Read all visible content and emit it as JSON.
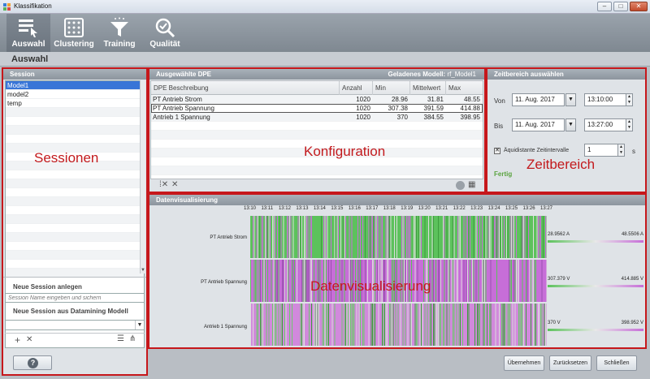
{
  "window": {
    "title": "Klassifikation",
    "controls": [
      "–",
      "□",
      "✕"
    ]
  },
  "toolbar": {
    "items": [
      {
        "label": "Auswahl",
        "icon": "selection-list-icon",
        "active": true
      },
      {
        "label": "Clustering",
        "icon": "cluster-grid-icon",
        "active": false
      },
      {
        "label": "Training",
        "icon": "filter-funnel-icon",
        "active": false
      },
      {
        "label": "Qualität",
        "icon": "magnifier-check-icon",
        "active": false
      }
    ]
  },
  "section": {
    "title": "Auswahl"
  },
  "session": {
    "header": "Session",
    "items": [
      "Model1",
      "model2",
      "temp"
    ],
    "selected": "Model1",
    "annotation": "Sessionen",
    "new_session_label": "Neue Session anlegen",
    "new_session_placeholder": "Session Name eingeben und sichern",
    "new_dm_label": "Neue Session aus Datamining Modell",
    "help": "?"
  },
  "config": {
    "header": "Ausgewählte DPE",
    "model_label": "Geladenes Modell:",
    "model_value": "rf_Model1",
    "annotation": "Konfiguration",
    "columns": [
      "DPE Beschreibung",
      "Anzahl",
      "Min",
      "Mittelwert",
      "Max"
    ],
    "rows": [
      [
        "PT Antrieb Strom",
        "1020",
        "28.96",
        "31.81",
        "48.55"
      ],
      [
        "PT Antrieb Spannung",
        "1020",
        "307.38",
        "391.59",
        "414.88"
      ],
      [
        "Antrieb 1 Spannung",
        "1020",
        "370",
        "384.55",
        "398.95"
      ]
    ]
  },
  "time": {
    "header": "Zeitbereich auswählen",
    "von_label": "Von",
    "von_date": "11. Aug. 2017",
    "von_time": "13:10:00",
    "bis_label": "Bis",
    "bis_date": "11. Aug. 2017",
    "bis_time": "13:27:00",
    "equidistant_label": "Äquidistante Zeitintervalle",
    "equidistant_checked": true,
    "interval_value": "1",
    "interval_unit": "s",
    "status": "Fertig",
    "annotation": "Zeitbereich"
  },
  "vis": {
    "header": "Datenvisualisierung",
    "annotation": "Datenvisualisierung",
    "ticks": [
      "13:10",
      "13:11",
      "13:12",
      "13:13",
      "13:14",
      "13:15",
      "13:16",
      "13:17",
      "13:18",
      "13:19",
      "13:20",
      "13:21",
      "13:22",
      "13:23",
      "13:24",
      "13:25",
      "13:26",
      "13:27"
    ],
    "rows": [
      {
        "label": "PT Antrieb Strom",
        "min": "28.9562 A",
        "max": "48.5506 A",
        "dominant": "#5cc25c",
        "secondary": "#c76ed8"
      },
      {
        "label": "PT Antrieb Spannung",
        "min": "307.379 V",
        "max": "414.885 V",
        "dominant": "#c76ed8",
        "secondary": "#5cc25c"
      },
      {
        "label": "Antrieb 1 Spannung",
        "min": "370 V",
        "max": "398.952 V",
        "dominant": "#d189dc",
        "secondary": "#6ec86e"
      }
    ]
  },
  "footer": {
    "apply": "Übernehmen",
    "reset": "Zurücksetzen",
    "close": "Schließen"
  },
  "colors": {
    "accent_red": "#c6171b",
    "selection": "#3875d7",
    "green": "#5cc25c",
    "magenta": "#c76ed8"
  }
}
